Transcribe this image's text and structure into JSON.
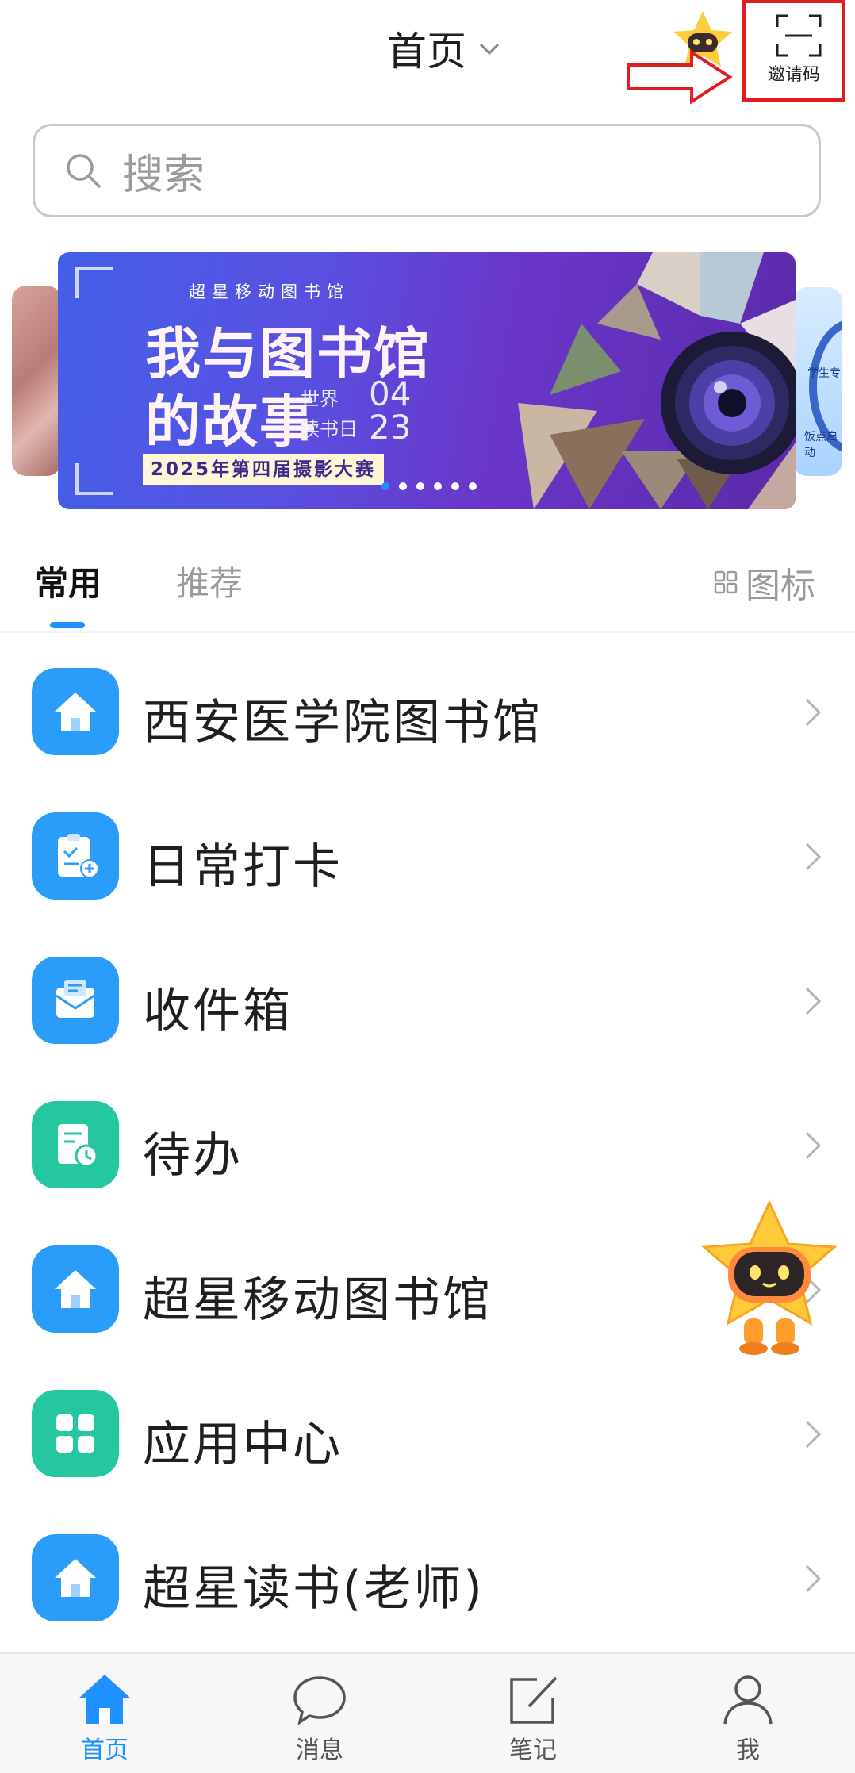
{
  "header": {
    "title": "首页",
    "scan_label": "邀请码"
  },
  "search": {
    "placeholder": "搜索"
  },
  "banner": {
    "subtitle": "超星移动图书馆",
    "headline_1": "我与图书馆",
    "headline_2": "的故事",
    "world": "世界",
    "reading_day": "读书日",
    "month": "04",
    "day": "23",
    "contest": "2025年第四届摄影大赛",
    "side_right_text_1": "学生专",
    "side_right_text_2": "饭点启动",
    "slide_count": 6,
    "active_slide": 1
  },
  "tabs": {
    "common": "常用",
    "recommend": "推荐",
    "icon_view": "图标"
  },
  "list": [
    {
      "label": "西安医学院图书馆",
      "icon": "home-icon",
      "color": "#2a9dfb"
    },
    {
      "label": "日常打卡",
      "icon": "clipboard-checkin-icon",
      "color": "#2a9dfb"
    },
    {
      "label": "收件箱",
      "icon": "inbox-envelope-icon",
      "color": "#2a9dfb"
    },
    {
      "label": "待办",
      "icon": "todo-clock-icon",
      "color": "#25c7a0"
    },
    {
      "label": "超星移动图书馆",
      "icon": "home-icon",
      "color": "#2a9dfb"
    },
    {
      "label": "应用中心",
      "icon": "app-grid-icon",
      "color": "#25c7a0"
    },
    {
      "label": "超星读书(老师)",
      "icon": "home-icon",
      "color": "#2a9dfb"
    }
  ],
  "bottom_nav": {
    "home": "首页",
    "messages": "消息",
    "notes": "笔记",
    "me": "我"
  },
  "colors": {
    "accent": "#1e90ff",
    "highlight_red": "#e01c24"
  }
}
